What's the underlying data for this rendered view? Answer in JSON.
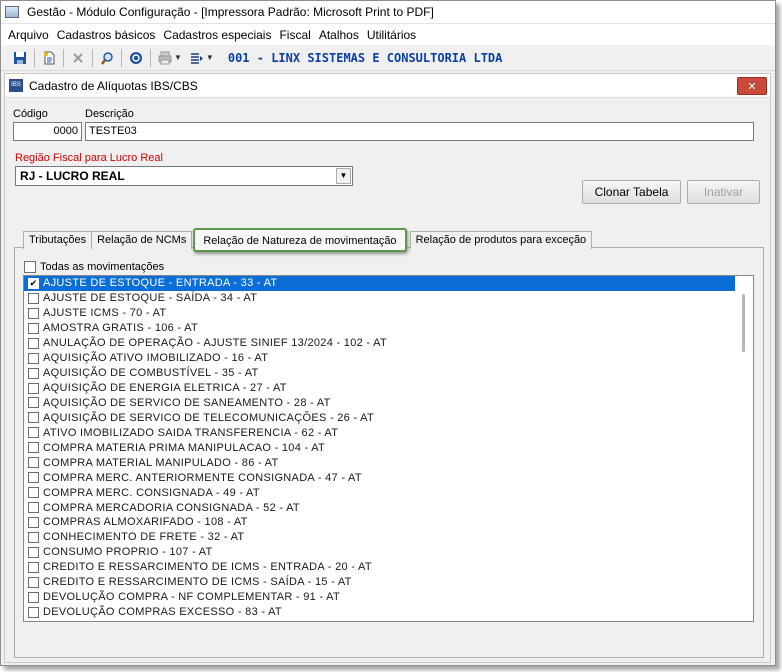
{
  "window": {
    "title": "Gestão  - Módulo Configuração - [Impressora Padrão: Microsoft Print to PDF]"
  },
  "menu": [
    "Arquivo",
    "Cadastros básicos",
    "Cadastros especiais",
    "Fiscal",
    "Atalhos",
    "Utilitários"
  ],
  "toolbar": {
    "company": "001 - LINX SISTEMAS E CONSULTORIA LTDA"
  },
  "form": {
    "title": "Cadastro de Alíquotas IBS/CBS",
    "close": "✕",
    "codigo_label": "Código",
    "codigo_value": "0000",
    "descricao_label": "Descrição",
    "descricao_value": "TESTE03",
    "regiao_label": "Região Fiscal para Lucro Real",
    "regiao_value": "RJ - LUCRO REAL",
    "clonar_label": "Clonar Tabela",
    "inativar_label": "Inativar"
  },
  "tabs": [
    "Tributações",
    "Relação de NCMs",
    "Relação de Natureza de movimentação",
    "Relação de produtos para exceção"
  ],
  "active_tab": 2,
  "check_all_label": "Todas as movimentações",
  "items": [
    {
      "label": "AJUSTE DE ESTOQUE - ENTRADA - 33 - AT",
      "checked": true,
      "selected": true
    },
    {
      "label": "AJUSTE DE ESTOQUE - SAÍDA - 34 - AT",
      "checked": false
    },
    {
      "label": "AJUSTE ICMS - 70 - AT",
      "checked": false
    },
    {
      "label": "AMOSTRA GRATIS - 106 - AT",
      "checked": false
    },
    {
      "label": "ANULAÇÃO DE OPERAÇÃO - AJUSTE SINIEF 13/2024 - 102 - AT",
      "checked": false
    },
    {
      "label": "AQUISIÇÃO ATIVO IMOBILIZADO - 16 - AT",
      "checked": false
    },
    {
      "label": "AQUISIÇÃO DE COMBUSTÍVEL - 35 - AT",
      "checked": false
    },
    {
      "label": "AQUISIÇÃO DE ENERGIA ELETRICA - 27 - AT",
      "checked": false
    },
    {
      "label": "AQUISIÇÃO DE SERVICO DE SANEAMENTO - 28 - AT",
      "checked": false
    },
    {
      "label": "AQUISIÇÃO DE SERVICO DE TELECOMUNICAÇÕES - 26 - AT",
      "checked": false
    },
    {
      "label": "ATIVO IMOBILIZADO SAIDA TRANSFERENCIA - 62 - AT",
      "checked": false
    },
    {
      "label": "COMPRA MATERIA PRIMA MANIPULACAO - 104 - AT",
      "checked": false
    },
    {
      "label": "COMPRA MATERIAL MANIPULADO - 86 - AT",
      "checked": false
    },
    {
      "label": "COMPRA MERC. ANTERIORMENTE CONSIGNADA - 47 - AT",
      "checked": false
    },
    {
      "label": "COMPRA MERC. CONSIGNADA - 49 - AT",
      "checked": false
    },
    {
      "label": "COMPRA MERCADORIA CONSIGNADA - 52 - AT",
      "checked": false
    },
    {
      "label": "COMPRAS ALMOXARIFADO - 108 - AT",
      "checked": false
    },
    {
      "label": "CONHECIMENTO DE FRETE - 32 - AT",
      "checked": false
    },
    {
      "label": "CONSUMO PROPRIO - 107 - AT",
      "checked": false
    },
    {
      "label": "CREDITO E RESSARCIMENTO DE ICMS - ENTRADA - 20 - AT",
      "checked": false
    },
    {
      "label": "CREDITO E RESSARCIMENTO DE ICMS - SAÍDA - 15 - AT",
      "checked": false
    },
    {
      "label": "DEVOLUÇÃO COMPRA - NF COMPLEMENTAR - 91 - AT",
      "checked": false
    },
    {
      "label": "DEVOLUÇÃO COMPRAS EXCESSO - 83 - AT",
      "checked": false
    }
  ],
  "colors": {
    "selection": "#0a6ed6",
    "company": "#0b3fa8",
    "required_label": "#d40000",
    "active_tab_border": "#5a9a4a"
  }
}
